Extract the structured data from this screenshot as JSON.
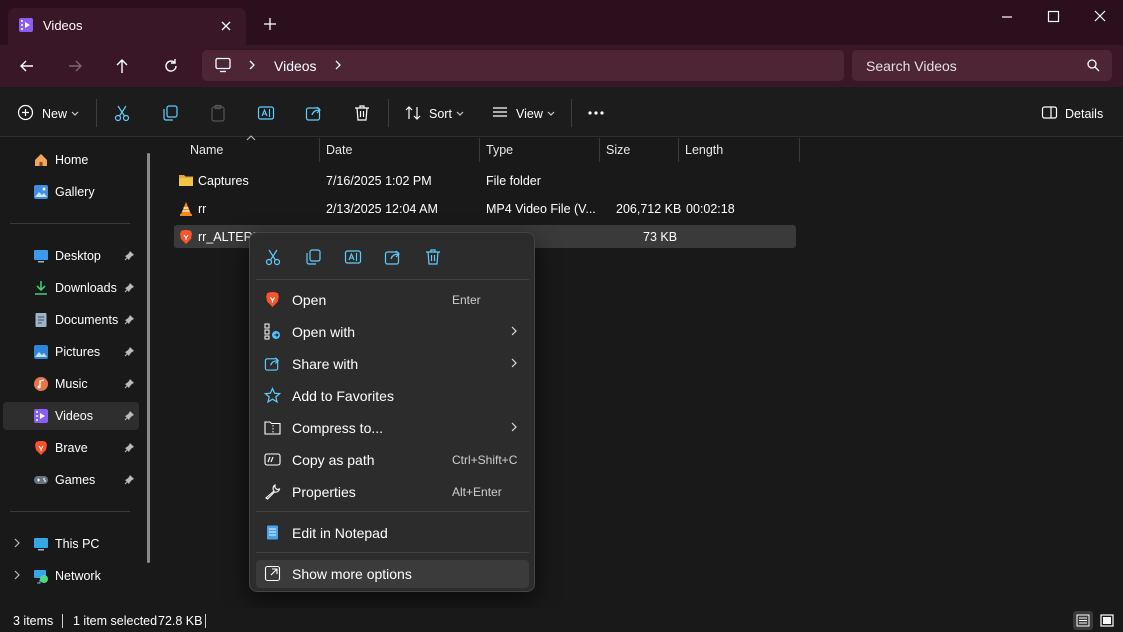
{
  "window": {
    "tab_title": "Videos",
    "new_tab_label": "+"
  },
  "address": {
    "crumb": "Videos",
    "search_placeholder": "Search Videos"
  },
  "toolbar": {
    "new_label": "New",
    "sort_label": "Sort",
    "view_label": "View",
    "details_label": "Details"
  },
  "sidebar": {
    "items": [
      {
        "label": "Home",
        "icon": "home-icon"
      },
      {
        "label": "Gallery",
        "icon": "gallery-icon"
      },
      {
        "label": "Desktop",
        "icon": "desktop-icon",
        "pinned": true
      },
      {
        "label": "Downloads",
        "icon": "downloads-icon",
        "pinned": true
      },
      {
        "label": "Documents",
        "icon": "documents-icon",
        "pinned": true
      },
      {
        "label": "Pictures",
        "icon": "pictures-icon",
        "pinned": true
      },
      {
        "label": "Music",
        "icon": "music-icon",
        "pinned": true
      },
      {
        "label": "Videos",
        "icon": "videos-icon",
        "pinned": true,
        "active": true
      },
      {
        "label": "Brave",
        "icon": "brave-icon",
        "pinned": true
      },
      {
        "label": "Games",
        "icon": "games-icon",
        "pinned": true
      },
      {
        "label": "This PC",
        "icon": "this-pc-icon"
      },
      {
        "label": "Network",
        "icon": "network-icon"
      }
    ]
  },
  "columns": [
    "Name",
    "Date",
    "Type",
    "Size",
    "Length"
  ],
  "files": [
    {
      "name": "Captures",
      "date": "7/16/2025 1:02 PM",
      "type": "File folder",
      "size": "",
      "length": "",
      "icon": "folder-icon"
    },
    {
      "name": "rr",
      "date": "2/13/2025 12:04 AM",
      "type": "MP4 Video File (V...",
      "size": "206,712 KB",
      "length": "00:02:18",
      "icon": "vlc-icon"
    },
    {
      "name": "rr_ALTERED",
      "date": "",
      "type": "",
      "size": "73 KB",
      "length": "",
      "icon": "brave-icon",
      "selected": true
    }
  ],
  "context_menu": {
    "quick_actions": [
      "cut-icon",
      "copy-icon",
      "rename-icon",
      "share-icon",
      "delete-icon"
    ],
    "items": [
      {
        "label": "Open",
        "shortcut": "Enter",
        "icon": "brave-icon"
      },
      {
        "label": "Open with",
        "submenu": true,
        "icon": "open-with-icon"
      },
      {
        "label": "Share with",
        "submenu": true,
        "icon": "share-icon"
      },
      {
        "label": "Add to Favorites",
        "icon": "star-icon"
      },
      {
        "label": "Compress to...",
        "submenu": true,
        "icon": "compress-icon"
      },
      {
        "label": "Copy as path",
        "shortcut": "Ctrl+Shift+C",
        "icon": "copy-path-icon"
      },
      {
        "label": "Properties",
        "shortcut": "Alt+Enter",
        "icon": "wrench-icon"
      },
      {
        "label": "Edit in Notepad",
        "icon": "notepad-icon"
      },
      {
        "label": "Show more options",
        "icon": "more-options-icon",
        "hover": true
      }
    ]
  },
  "status": {
    "item_count": "3 items",
    "selection": "1 item selected",
    "selection_size": "72.8 KB"
  },
  "colors": {
    "title_bg": "#2b0f1d",
    "address_bg": "#3a1726",
    "content_bg": "#191919",
    "menu_bg": "#2c2c2c",
    "brave_orange": "#fb542b",
    "folder_yellow": "#f4c542",
    "accent_blue": "#4cc2ff"
  }
}
